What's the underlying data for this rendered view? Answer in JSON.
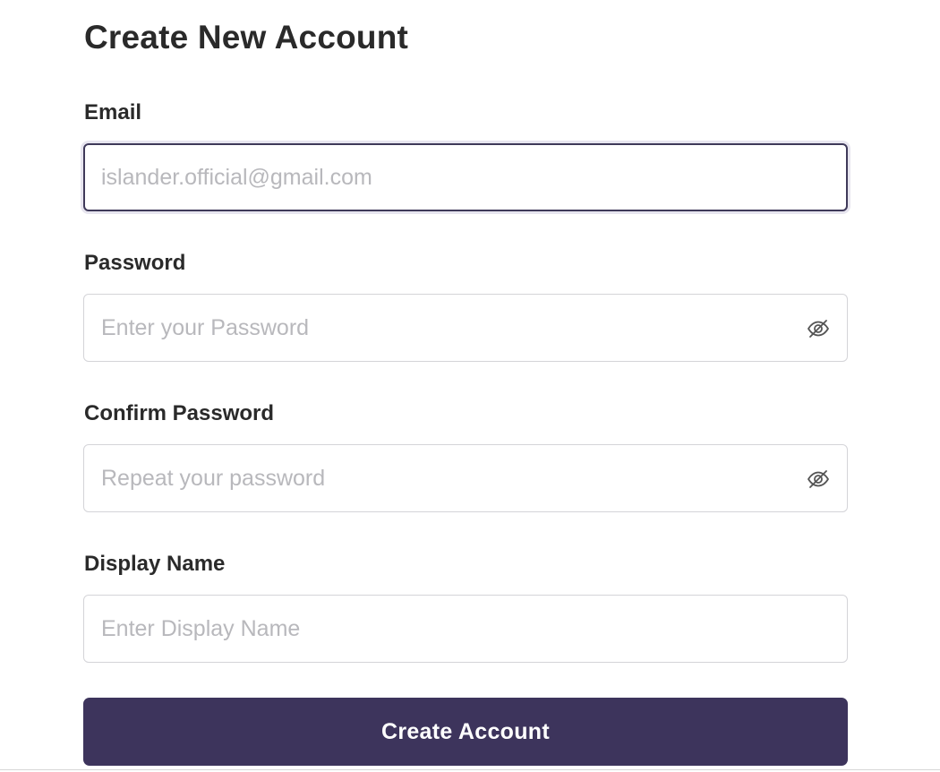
{
  "form": {
    "title": "Create New Account",
    "fields": {
      "email": {
        "label": "Email",
        "placeholder": "islander.official@gmail.com",
        "value": ""
      },
      "password": {
        "label": "Password",
        "placeholder": "Enter your Password",
        "value": "",
        "toggle_icon": "eye-off-icon"
      },
      "confirm_password": {
        "label": "Confirm Password",
        "placeholder": "Repeat your password",
        "value": "",
        "toggle_icon": "eye-off-icon"
      },
      "display_name": {
        "label": "Display Name",
        "placeholder": "Enter Display Name",
        "value": ""
      }
    },
    "submit_label": "Create Account"
  },
  "colors": {
    "primary": "#3d345c",
    "focus_border": "#3f3a5a",
    "input_border": "#d4d4d8",
    "placeholder": "#b8b8bc",
    "text": "#2a2a2a"
  }
}
